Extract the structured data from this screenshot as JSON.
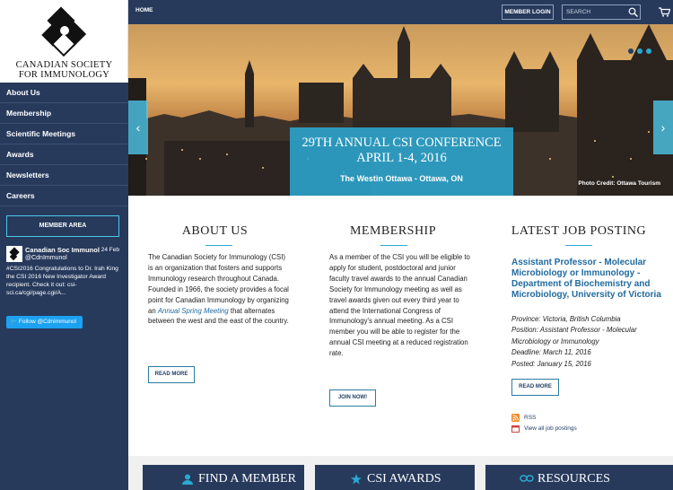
{
  "brand": {
    "line1": "CANADIAN SOCIETY",
    "line2": "FOR IMMUNOLOGY"
  },
  "sidebar": {
    "items": [
      {
        "label": "About Us"
      },
      {
        "label": "Membership"
      },
      {
        "label": "Scientific Meetings"
      },
      {
        "label": "Awards"
      },
      {
        "label": "Newsletters"
      },
      {
        "label": "Careers"
      }
    ],
    "member_area_label": "MEMBER AREA",
    "tweet": {
      "name": "Canadian Soc Immunol",
      "handle": "@CdnImmunol",
      "date": "24 Feb",
      "text": "#CSI2016 Congratulations to Dr. Irah King the CSI 2016 New Investigator Award recipient. Check it out: csi-sci.ca/cgi/page.cgi/A..."
    },
    "follow_label": "Follow @CdnImmunol"
  },
  "topbar": {
    "home": "HOME",
    "member_login": "MEMBER LOGIN",
    "search_placeholder": "SEARCH"
  },
  "hero": {
    "title_line1": "29TH ANNUAL CSI CONFERENCE",
    "title_line2": "APRIL 1-4, 2016",
    "subtitle": "The Westin Ottawa - Ottawa, ON",
    "photo_credit": "Photo Credit: Ottawa Tourism",
    "prev": "‹",
    "next": "›",
    "slide_count": 3,
    "active_slide": 1
  },
  "about": {
    "title": "ABOUT US",
    "text_before_link": "The Canadian Society for Immunology (CSI) is an organization that fosters and supports Immunology research throughout Canada. Founded in 1966, the society provides a focal point for Canadian Immunology by organizing an ",
    "link": "Annual Spring Meeting",
    "text_after_link": " that alternates between the west and the east of the country.",
    "button": "READ MORE"
  },
  "membership": {
    "title": "MEMBERSHIP",
    "text": "As a member of the CSI you will be eligible to apply for student, postdoctoral and junior faculty travel awards to the annual Canadian Society for Immunology meeting as well as travel awards given out every third year to attend the International Congress of Immunology's annual meeting. As a CSI member you will be able to register for the annual CSI meeting at a reduced registration rate.",
    "button": "JOIN NOW!"
  },
  "jobs": {
    "title": "LATEST JOB POSTING",
    "job_title": "Assistant Professor - Molecular Microbiology or Immunology - Department of Biochemistry and Microbiology, University of Victoria",
    "province": "Province: Victoria, British Columbia",
    "position": "Position: Assistant Professor - Molecular Microbiology or Immunology",
    "deadline": "Deadline: March 11, 2016",
    "posted": "Posted: January 15, 2016",
    "button": "READ MORE",
    "rss": "RSS",
    "all": "View all job postings"
  },
  "bottom": {
    "find_member": "FIND A MEMBER",
    "awards": "CSI AWARDS",
    "resources": "RESOURCES"
  },
  "colors": {
    "navy": "#273a5c",
    "accent": "#2aa9d1",
    "link": "#1f6aa0"
  },
  "icons": [
    "search-icon",
    "cart-icon",
    "rss-icon",
    "calendar-icon",
    "person-icon",
    "star-icon",
    "link-icon",
    "twitter-icon"
  ]
}
